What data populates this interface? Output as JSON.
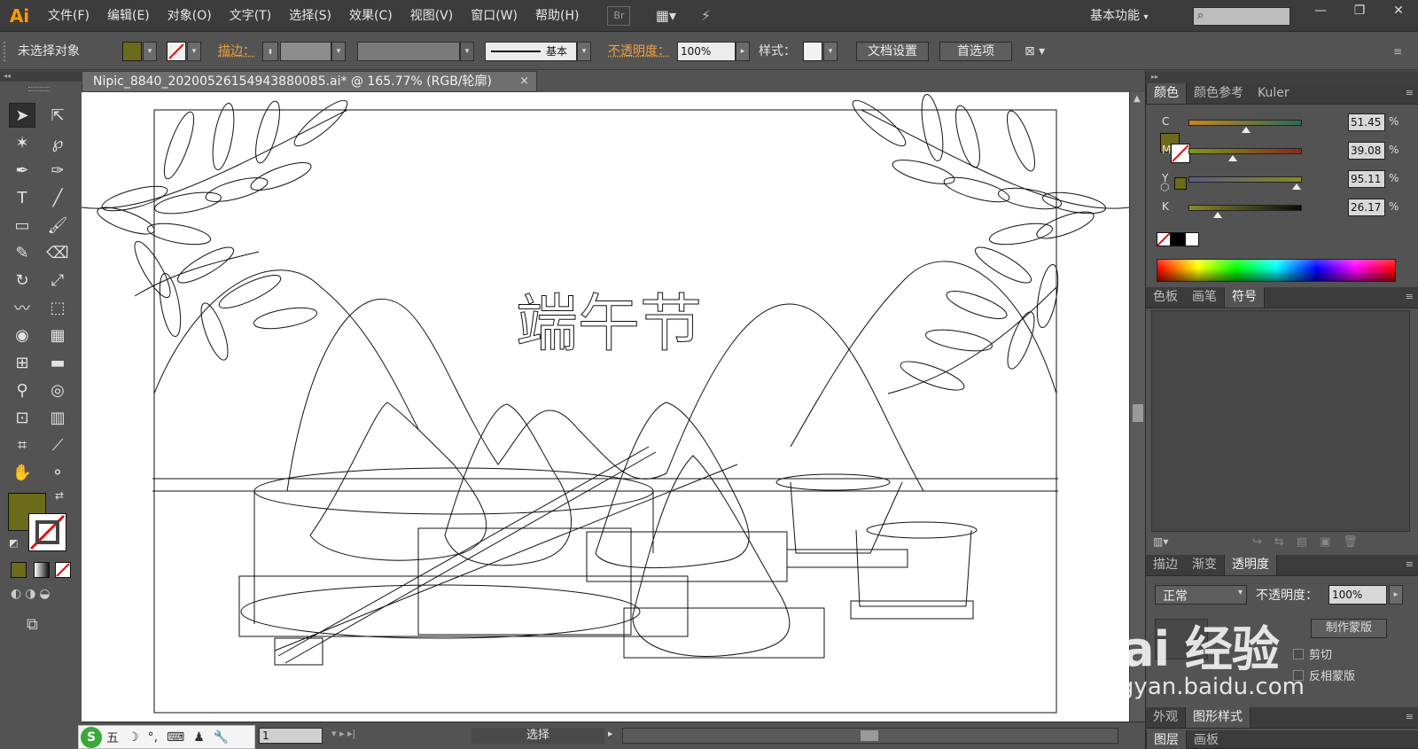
{
  "app": {
    "logo": "Ai",
    "menu": [
      "文件(F)",
      "编辑(E)",
      "对象(O)",
      "文字(T)",
      "选择(S)",
      "效果(C)",
      "视图(V)",
      "窗口(W)",
      "帮助(H)"
    ],
    "bridge_label": "Br",
    "workspace": "基本功能",
    "window_controls": [
      "—",
      "❐",
      "✕"
    ]
  },
  "control_bar": {
    "selection_status": "未选择对象",
    "stroke_label": "描边：",
    "stroke_style": "基本",
    "opacity_label": "不透明度：",
    "opacity_value": "100%",
    "style_label": "样式：",
    "doc_setup_button": "文档设置",
    "preferences_button": "首选项"
  },
  "document": {
    "tab_title": "Nipic_8840_20200526154943880085.ai* @ 165.77% (RGB/轮廓)",
    "close_glyph": "×",
    "artwork_title": "端午节"
  },
  "status_bar": {
    "zoom_value": "1",
    "status_text": "选择"
  },
  "ime": {
    "logo": "S",
    "items": [
      "五",
      "☽",
      "°,",
      "⌨",
      "♟",
      "🔧"
    ]
  },
  "panels": {
    "color_tabs": [
      "颜色",
      "颜色参考",
      "Kuler"
    ],
    "cmyk": [
      {
        "label": "C",
        "value": "51.45",
        "fill": 0.51
      },
      {
        "label": "M",
        "value": "39.08",
        "fill": 0.39
      },
      {
        "label": "Y",
        "value": "95.11",
        "fill": 0.95
      },
      {
        "label": "K",
        "value": "26.17",
        "fill": 0.26
      }
    ],
    "percent_sign": "%",
    "swatch_tabs": [
      "色板",
      "画笔",
      "符号"
    ],
    "appearance_tabs": [
      "描边",
      "渐变",
      "透明度"
    ],
    "blend_mode": "正常",
    "opacity_label": "不透明度：",
    "opacity_value": "100%",
    "make_mask_button": "制作蒙版",
    "clip_label": "剪切",
    "invert_mask_label": "反相蒙版",
    "bottom_tabs": [
      "外观",
      "图形样式"
    ],
    "layer_tabs": [
      "图层",
      "画板"
    ]
  },
  "colors": {
    "fill": "#6b6b1a",
    "accent_orange": "#f0a040"
  },
  "watermark": {
    "main": "Bai 经验",
    "sub": "jingyan.baidu.com"
  }
}
